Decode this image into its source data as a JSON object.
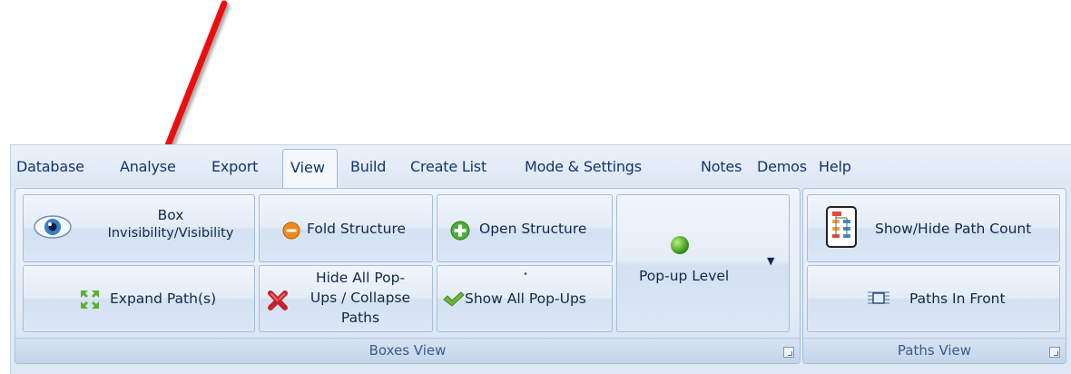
{
  "tabs": [
    "Database",
    "Analyse",
    "Export",
    "View",
    "Build",
    "Create List",
    "Mode & Settings",
    "Notes",
    "Demos",
    "Help"
  ],
  "active_tab": "View",
  "groups": {
    "boxes_view": {
      "label": "Boxes View",
      "box_visibility": [
        "Box",
        "Invisibility/Visibility"
      ],
      "fold_structure": "Fold Structure",
      "open_structure": "Open Structure",
      "expand_paths": "Expand Path(s)",
      "hide_popups": [
        "Hide All Pop-",
        "Ups / Collapse",
        "Paths"
      ],
      "show_popups": "Show All Pop-Ups",
      "popup_level": "Pop-up Level"
    },
    "paths_view": {
      "label": "Paths View",
      "show_hide_path_count": "Show/Hide Path Count",
      "paths_in_front": "Paths In Front"
    }
  },
  "icons": {
    "box_visibility": "eye-icon",
    "fold_structure": "minus-circle-icon",
    "open_structure": "plus-circle-icon",
    "expand_paths": "expand-arrows-icon",
    "hide_popups": "red-x-icon",
    "show_popups": "checkmark-icon",
    "popup_level": "green-dot-icon",
    "path_count": "flowchart-icon",
    "paths_in_front": "layers-icon",
    "annotation": "red-arrow-icon"
  },
  "colors": {
    "annotation_arrow": "#ee1111",
    "accent": "#15356b"
  }
}
